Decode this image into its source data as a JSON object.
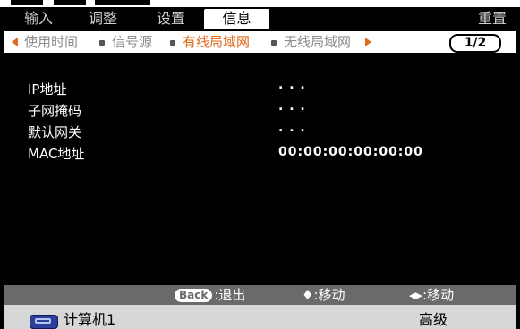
{
  "tabs": [
    "输入",
    "调整",
    "设置",
    "信息"
  ],
  "active_tab": "信息",
  "reset_label": "重置",
  "subnav": {
    "items": [
      "使用时间",
      "信号源",
      "有线局域网",
      "无线局域网"
    ],
    "active": "有线局域网",
    "page": "1/2"
  },
  "info": {
    "rows": [
      {
        "label": "IP地址",
        "value": ". . ."
      },
      {
        "label": "子网掩码",
        "value": ". . ."
      },
      {
        "label": "默认网关",
        "value": ". . ."
      },
      {
        "label": "MAC地址",
        "value": "00:00:00:00:00:00"
      }
    ]
  },
  "help": {
    "back_key": "Back",
    "back_label": ":退出",
    "move_ud_symbol": "♦:移动",
    "move_lr_symbol": "◂▸:移动"
  },
  "status": {
    "source": "计算机1",
    "mode": "高级",
    "source_icon": "computer-source-icon"
  }
}
